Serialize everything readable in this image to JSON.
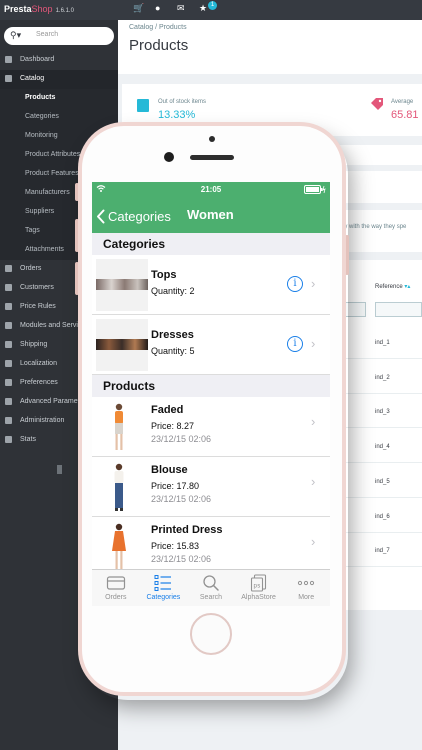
{
  "admin": {
    "logo_presta": "Presta",
    "logo_shop": "Shop",
    "version": "1.6.1.0",
    "notification_count": "1",
    "search_placeholder": "Search",
    "sidebar": {
      "dashboard": "Dashboard",
      "catalog": "Catalog",
      "catalog_sub": [
        "Products",
        "Categories",
        "Monitoring",
        "Product Attributes",
        "Product Features",
        "Manufacturers",
        "Suppliers",
        "Tags",
        "Attachments"
      ],
      "orders": "Orders",
      "customers": "Customers",
      "price_rules": "Price Rules",
      "modules": "Modules and Services",
      "shipping": "Shipping",
      "localization": "Localization",
      "preferences": "Preferences",
      "advanced": "Advanced Parameters",
      "administration": "Administration",
      "stats": "Stats"
    },
    "breadcrumb": "Catalog  /  Products",
    "page_title": "Products",
    "kpi_out_of_stock_label": "Out of stock items",
    "kpi_out_of_stock_value": "13.33%",
    "kpi_average_label": "Average",
    "kpi_average_value": "65.81",
    "help_text": "py with the way they spe",
    "reference_header": "Reference",
    "references": [
      "ind_1",
      "ind_2",
      "ind_3",
      "ind_4",
      "ind_5",
      "ind_6",
      "ind_7"
    ]
  },
  "app": {
    "status_time": "21:05",
    "back_label": "Categories",
    "title": "Women",
    "categories_header": "Categories",
    "categories": [
      {
        "name": "Tops",
        "quantity": "Quantity: 2"
      },
      {
        "name": "Dresses",
        "quantity": "Quantity: 5"
      }
    ],
    "products_header": "Products",
    "products": [
      {
        "name": "Faded",
        "price": "Price: 8.27",
        "date": "23/12/15 02:06"
      },
      {
        "name": "Blouse",
        "price": "Price: 17.80",
        "date": "23/12/15 02:06"
      },
      {
        "name": "Printed Dress",
        "price": "Price: 15.83",
        "date": "23/12/15 02:06"
      }
    ],
    "tabs": [
      "Orders",
      "Categories",
      "Search",
      "AlphaStore",
      "More"
    ],
    "colors": {
      "accent_green": "#4caf6f",
      "ios_blue": "#1a7fe8"
    }
  }
}
